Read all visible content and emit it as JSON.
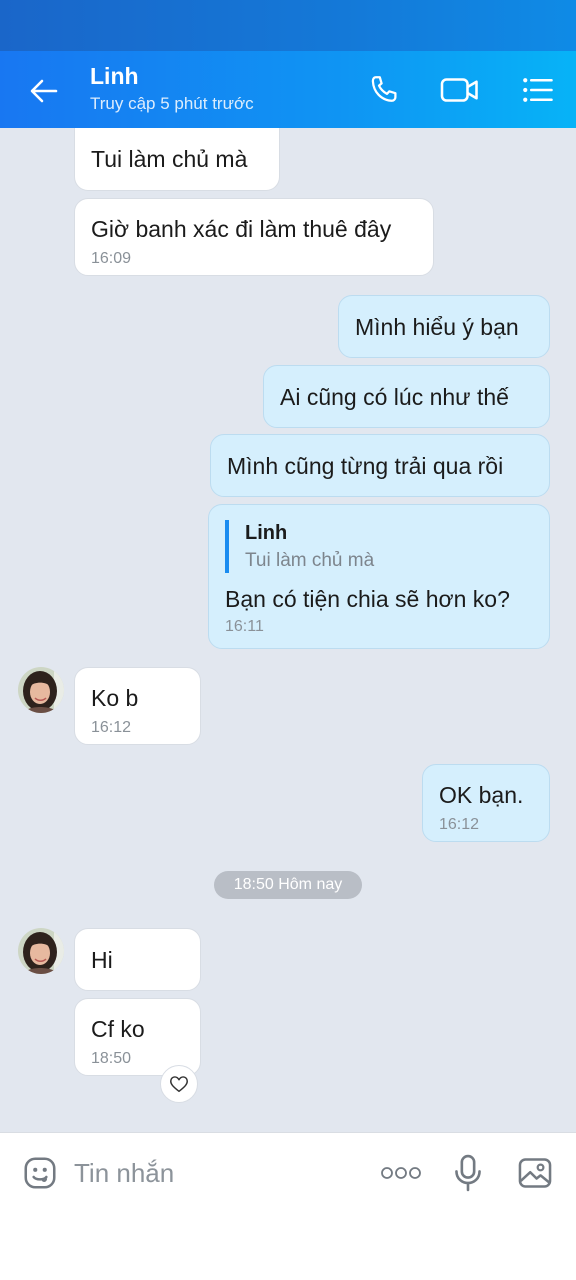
{
  "header": {
    "contact_name": "Linh",
    "contact_status": "Truy cập 5 phút trước",
    "icons": [
      "back-arrow-icon",
      "phone-icon",
      "video-call-icon",
      "menu-list-icon"
    ]
  },
  "messages": [
    {
      "dir": "in",
      "text": "Tui làm chủ mà",
      "time": ""
    },
    {
      "dir": "in",
      "text": "Giờ banh xác đi làm thuê đây",
      "time": "16:09"
    },
    {
      "dir": "out",
      "text": "Mình hiểu ý bạn",
      "time": ""
    },
    {
      "dir": "out",
      "text": "Ai cũng có lúc như thế",
      "time": ""
    },
    {
      "dir": "out",
      "text": "Mình cũng từng trải qua rồi",
      "time": ""
    },
    {
      "dir": "out",
      "reply_to": {
        "name": "Linh",
        "text": "Tui làm chủ mà"
      },
      "text": "Bạn có tiện chia sẽ hơn ko?",
      "time": "16:11"
    },
    {
      "dir": "in",
      "text": "Ko b",
      "time": "16:12"
    },
    {
      "dir": "out",
      "text": "OK bạn.",
      "time": "16:12"
    },
    {
      "dir": "in",
      "text": "Hi",
      "time": ""
    },
    {
      "dir": "in",
      "text": "Cf ko",
      "time": "18:50"
    }
  ],
  "date_divider": "18:50 Hôm nay",
  "composer": {
    "placeholder": "Tin nhắn",
    "icons": [
      "sticker-icon",
      "more-dots-icon",
      "microphone-icon",
      "image-icon"
    ]
  },
  "colors": {
    "header_start": "#1877f2",
    "header_end": "#07b3f7",
    "chat_bg": "#e2e7ef",
    "outgoing_bubble": "#d5effd",
    "incoming_bubble": "#ffffff",
    "quote_bar": "#1a8cf0"
  }
}
